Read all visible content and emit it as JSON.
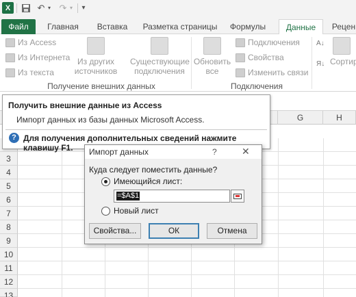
{
  "quick_access": {
    "app_icon": "excel-logo",
    "app_letter": "X",
    "icons": [
      "save-icon",
      "undo-icon",
      "redo-icon",
      "customize-icon"
    ]
  },
  "tabs": [
    {
      "label": "Файл",
      "active": false
    },
    {
      "label": "Главная",
      "active": false
    },
    {
      "label": "Вставка",
      "active": false
    },
    {
      "label": "Разметка страницы",
      "active": false
    },
    {
      "label": "Формулы",
      "active": false
    },
    {
      "label": "Данные",
      "active": true
    },
    {
      "label": "Рецен",
      "active": false
    }
  ],
  "ribbon": {
    "get_external": {
      "from_access": "Из Access",
      "from_web": "Из Интернета",
      "from_text": "Из текста",
      "from_other_line1": "Из других",
      "from_other_line2": "источников",
      "existing_line1": "Существующие",
      "existing_line2": "подключения",
      "group_label": "Получение внешних данных"
    },
    "connections": {
      "refresh_line1": "Обновить",
      "refresh_line2": "все",
      "connections": "Подключения",
      "properties": "Свойства",
      "edit_links": "Изменить связи",
      "group_label": "Подключения"
    },
    "sort": {
      "sort_label": "Сортир"
    }
  },
  "sheet": {
    "columns": [
      "G",
      "H"
    ],
    "rows": [
      "3",
      "4",
      "5",
      "6",
      "7",
      "8",
      "9",
      "10",
      "11",
      "12",
      "13"
    ]
  },
  "tooltip": {
    "title": "Получить внешние данные из Access",
    "description": "Импорт данных из базы данных Microsoft Access.",
    "help": "Для получения дополнительных сведений нажмите клавишу F1."
  },
  "dialog": {
    "title": "Импорт данных",
    "help_glyph": "?",
    "close_glyph": "✕",
    "prompt": "Куда следует поместить данные?",
    "existing_sheet": "Имеющийся лист:",
    "reference": "=$A$1",
    "new_sheet": "Новый лист",
    "properties_button": "Свойства...",
    "ok_button": "ОК",
    "cancel_button": "Отмена",
    "selected_option": "existing_sheet"
  },
  "colors": {
    "file_tab": "#217346",
    "active_tab_text": "#217346",
    "help_icon": "#2f6fb6"
  }
}
